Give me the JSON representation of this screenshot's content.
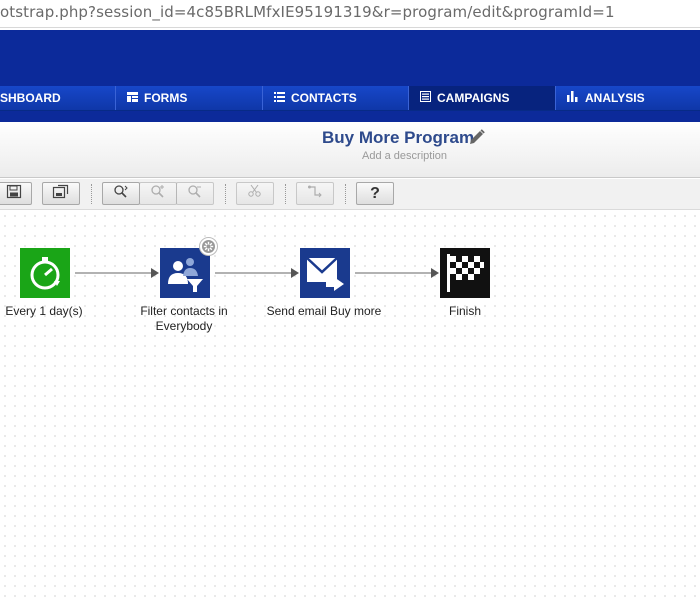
{
  "browser": {
    "url": "otstrap.php?session_id=4c85BRLMfxIE95191319&r=program/edit&programId=1"
  },
  "nav": {
    "items": [
      {
        "label": "SHBOARD",
        "icon": "dashboard-icon"
      },
      {
        "label": "FORMS",
        "icon": "forms-icon"
      },
      {
        "label": "CONTACTS",
        "icon": "list-icon"
      },
      {
        "label": "CAMPAIGNS",
        "icon": "document-icon",
        "active": true
      },
      {
        "label": "ANALYSIS",
        "icon": "bar-chart-icon"
      }
    ]
  },
  "program": {
    "title": "Buy More Program",
    "description": "Add a description"
  },
  "toolbar": {
    "buttons": [
      {
        "icon": "save-icon"
      },
      {
        "icon": "save-as-icon"
      },
      {
        "icon": "zoom-fit-icon"
      },
      {
        "icon": "zoom-in-icon",
        "disabled": true
      },
      {
        "icon": "zoom-out-icon",
        "disabled": true
      },
      {
        "icon": "cut-icon",
        "disabled": true
      },
      {
        "icon": "connector-icon",
        "disabled": true
      },
      {
        "icon": "help-icon",
        "label": "?"
      }
    ]
  },
  "flow": {
    "nodes": [
      {
        "label_line1": "Every 1 day(s)",
        "label_line2": "",
        "icon": "timer-icon",
        "color": "#1aa517"
      },
      {
        "label_line1": "Filter contacts in",
        "label_line2": "Everybody",
        "icon": "filter-contacts-icon",
        "color": "#1a3a8e"
      },
      {
        "label_line1": "Send email Buy more",
        "label_line2": "",
        "icon": "send-email-icon",
        "color": "#1a3a8e"
      },
      {
        "label_line1": "Finish",
        "label_line2": "",
        "icon": "finish-flag-icon",
        "color": "#111111"
      }
    ]
  },
  "colors": {
    "banner": "#0c2a9a",
    "nav_active": "#07237e",
    "title": "#2e4a8c"
  }
}
